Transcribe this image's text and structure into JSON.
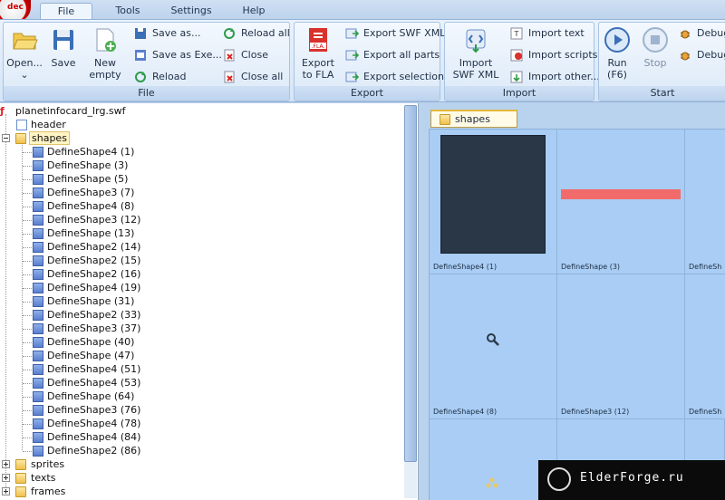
{
  "app": {
    "logo_text": "dec"
  },
  "menu": {
    "tabs": [
      "File",
      "Tools",
      "Settings",
      "Help"
    ],
    "active": "File"
  },
  "ribbon": {
    "file": {
      "title": "File",
      "open": "Open...",
      "save": "Save",
      "new_empty_1": "New",
      "new_empty_2": "empty",
      "save_as": "Save as...",
      "save_as_exe": "Save as Exe...",
      "reload": "Reload",
      "reload_all": "Reload all",
      "close": "Close",
      "close_all": "Close all"
    },
    "export": {
      "title": "Export",
      "export_fla_1": "Export",
      "export_fla_2": "to FLA",
      "fla_badge": ".FLA.",
      "export_swf_xml": "Export SWF XML",
      "export_all_parts": "Export all parts",
      "export_selection": "Export selection"
    },
    "import": {
      "title": "Import",
      "import_swf_xml_1": "Import",
      "import_swf_xml_2": "SWF XML",
      "import_text": "Import text",
      "import_scripts": "Import scripts",
      "import_other": "Import other..."
    },
    "start": {
      "title": "Start",
      "run_1": "Run",
      "run_2": "(F6)",
      "stop": "Stop",
      "debug_1": "Debug",
      "debug_2": "Debug"
    }
  },
  "tree": {
    "root": "planetinfocard_lrg.swf",
    "header": "header",
    "shapes": "shapes",
    "shape_items": [
      "DefineShape4 (1)",
      "DefineShape (3)",
      "DefineShape (5)",
      "DefineShape3 (7)",
      "DefineShape4 (8)",
      "DefineShape3 (12)",
      "DefineShape (13)",
      "DefineShape2 (14)",
      "DefineShape2 (15)",
      "DefineShape2 (16)",
      "DefineShape4 (19)",
      "DefineShape (31)",
      "DefineShape2 (33)",
      "DefineShape3 (37)",
      "DefineShape (40)",
      "DefineShape (47)",
      "DefineShape4 (51)",
      "DefineShape4 (53)",
      "DefineShape (64)",
      "DefineShape3 (76)",
      "DefineShape4 (78)",
      "DefineShape4 (84)",
      "DefineShape2 (86)"
    ],
    "sprites": "sprites",
    "texts": "texts",
    "frames": "frames"
  },
  "preview": {
    "tab_label": "shapes",
    "captions": [
      "DefineShape4 (1)",
      "DefineShape (3)",
      "DefineSh",
      "DefineShape4 (8)",
      "DefineShape3 (12)",
      "DefineSh"
    ]
  },
  "watermark": {
    "text": "ElderForge.ru"
  },
  "colors": {
    "shape1_fill": "#2a3747",
    "shape3_fill": "#f26b6b",
    "accent": "#bcd2ec"
  }
}
